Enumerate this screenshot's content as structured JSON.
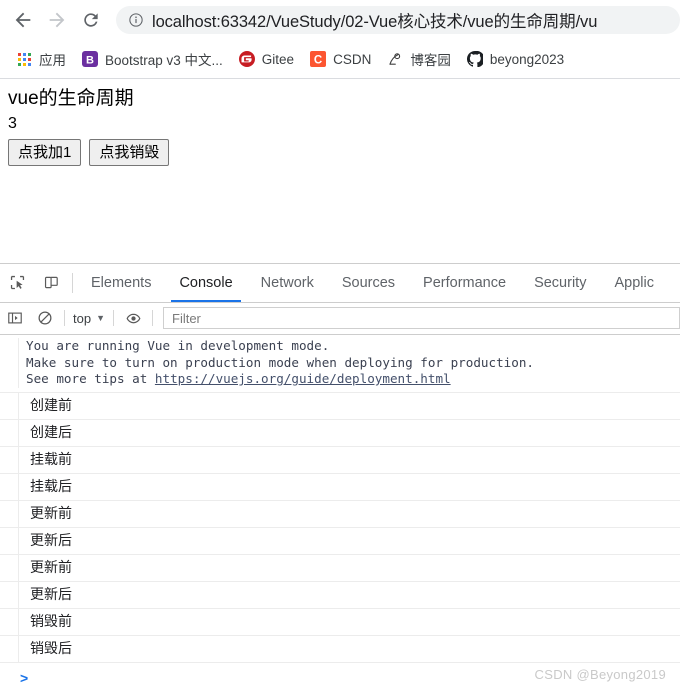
{
  "browser": {
    "nav": {
      "back_icon": "arrow-left-icon",
      "forward_icon": "arrow-right-icon",
      "reload_icon": "reload-icon",
      "info_icon": "info-circle-icon"
    },
    "omnibox": {
      "url": "localhost:63342/VueStudy/02-Vue核心技术/vue的生命周期/vu",
      "host": "localhost:63342"
    },
    "bookmarks": [
      {
        "label": "应用",
        "icon": "apps-grid-icon"
      },
      {
        "label": "Bootstrap v3 中文...",
        "icon": "bootstrap-icon"
      },
      {
        "label": "Gitee",
        "icon": "gitee-icon"
      },
      {
        "label": "CSDN",
        "icon": "csdn-icon"
      },
      {
        "label": "博客园",
        "icon": "cnblogs-icon"
      },
      {
        "label": "beyong2023",
        "icon": "github-icon"
      }
    ]
  },
  "page": {
    "title": "vue的生命周期",
    "counter": "3",
    "buttons": [
      {
        "label": "点我加1"
      },
      {
        "label": "点我销毁"
      }
    ]
  },
  "devtools": {
    "inspect_icon": "inspect-element-icon",
    "device_icon": "device-toolbar-icon",
    "tabs": [
      {
        "label": "Elements",
        "active": false
      },
      {
        "label": "Console",
        "active": true
      },
      {
        "label": "Network",
        "active": false
      },
      {
        "label": "Sources",
        "active": false
      },
      {
        "label": "Performance",
        "active": false
      },
      {
        "label": "Security",
        "active": false
      },
      {
        "label": "Applic",
        "active": false
      }
    ],
    "active_tab_accent": "#1a73e8",
    "filterbar": {
      "sidebar_icon": "console-sidebar-icon",
      "clear_icon": "clear-console-icon",
      "context": "top",
      "context_caret": "▼",
      "eye_icon": "live-expression-eye-icon",
      "filter_placeholder": "Filter"
    },
    "console": {
      "vue_message": {
        "line1": "You are running Vue in development mode.",
        "line2": "Make sure to turn on production mode when deploying for production.",
        "line3_prefix": "See more tips at ",
        "link": "https://vuejs.org/guide/deployment.html"
      },
      "logs": [
        "创建前",
        "创建后",
        "挂载前",
        "挂载后",
        "更新前",
        "更新后",
        "更新前",
        "更新后",
        "销毁前",
        "销毁后"
      ],
      "prompt": ">"
    },
    "watermark": "CSDN @Beyong2019"
  }
}
